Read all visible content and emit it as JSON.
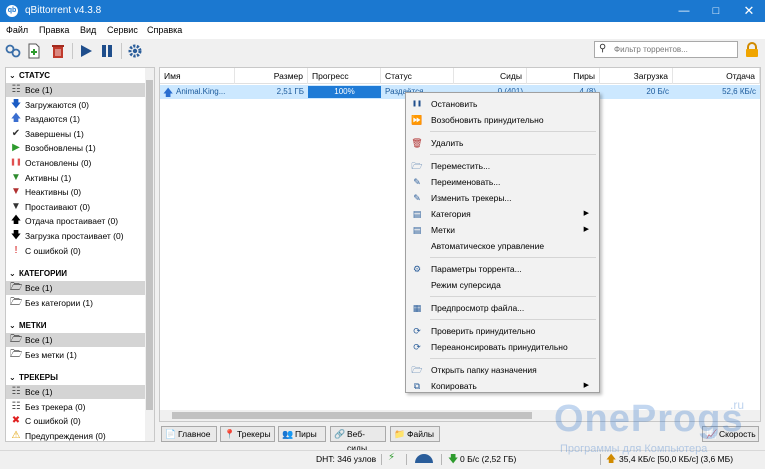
{
  "window": {
    "title": "qBittorrent v4.3.8",
    "app_icon": "qb"
  },
  "menubar": [
    "Файл",
    "Правка",
    "Вид",
    "Сервис",
    "Справка"
  ],
  "toolbar": {
    "icons": [
      "add-torrent-link-icon",
      "add-torrent-file-icon",
      "delete-icon",
      "resume-icon",
      "pause-icon",
      "options-gear-icon"
    ],
    "filter_placeholder": "Фильтр торрентов..."
  },
  "sidebar": {
    "status": {
      "title": "СТАТУС",
      "items": [
        {
          "label": "Все (1)",
          "icon": "all-icon",
          "color": "#555555"
        },
        {
          "label": "Загружаются (0)",
          "icon": "download-arrow-icon",
          "color": "#1a5bc4"
        },
        {
          "label": "Раздаются (1)",
          "icon": "upload-arrow-icon",
          "color": "#3a6ed0"
        },
        {
          "label": "Завершены (1)",
          "icon": "check-icon",
          "color": "#333333"
        },
        {
          "label": "Возобновлены (1)",
          "icon": "play-icon",
          "color": "#2e9b2e"
        },
        {
          "label": "Остановлены (0)",
          "icon": "pause-icon",
          "color": "#e05050"
        },
        {
          "label": "Активны (1)",
          "icon": "funnel-icon",
          "color": "#2e8b2e"
        },
        {
          "label": "Неактивны (0)",
          "icon": "funnel-icon",
          "color": "#b03030"
        },
        {
          "label": "Простаивают (0)",
          "icon": "funnel-icon",
          "color": "#333333"
        },
        {
          "label": "Отдача простаивает (0)",
          "icon": "up-arrow-icon",
          "color": "#000000"
        },
        {
          "label": "Загрузка простаивает (0)",
          "icon": "down-arrow-icon",
          "color": "#000000"
        },
        {
          "label": "С ошибкой (0)",
          "icon": "error-exclamation-icon",
          "color": "#d00000"
        }
      ]
    },
    "categories": {
      "title": "КАТЕГОРИИ",
      "items": [
        "Все (1)",
        "Без категории (1)"
      ]
    },
    "tags": {
      "title": "МЕТКИ",
      "items": [
        "Все (1)",
        "Без метки (1)"
      ]
    },
    "trackers": {
      "title": "ТРЕКЕРЫ",
      "items": [
        {
          "label": "Все (1)",
          "icon": "tracker-icon",
          "color": "#555555"
        },
        {
          "label": "Без трекера (0)",
          "icon": "tracker-icon",
          "color": "#555555"
        },
        {
          "label": "С ошибкой (0)",
          "icon": "error-circle-icon",
          "color": "#e02020"
        },
        {
          "label": "Предупреждения (0)",
          "icon": "warning-icon",
          "color": "#e0a000"
        }
      ]
    }
  },
  "table": {
    "columns": [
      "Имя",
      "Размер",
      "Прогресс",
      "Статус",
      "Сиды",
      "Пиры",
      "Загрузка",
      "Отдача"
    ],
    "rows": [
      {
        "name": "Animal.King...",
        "size": "2,51 ГБ",
        "progress_text": "100%",
        "progress": 1.0,
        "status": "Раздаётся",
        "seeds": "0 (401)",
        "peers": "4 (8)",
        "download": "20 Б/с",
        "upload": "52,6 КБ/с"
      }
    ]
  },
  "context_menu": {
    "items": [
      {
        "label": "Остановить",
        "icon": "pause-icon"
      },
      {
        "label": "Возобновить принудительно",
        "icon": "force-resume-icon"
      },
      {
        "separator": true
      },
      {
        "label": "Удалить",
        "icon": "delete-icon"
      },
      {
        "separator": true
      },
      {
        "label": "Переместить...",
        "icon": "folder-move-icon"
      },
      {
        "label": "Переименовать...",
        "icon": "rename-icon"
      },
      {
        "label": "Изменить трекеры...",
        "icon": "edit-trackers-icon"
      },
      {
        "label": "Категория",
        "icon": "category-icon",
        "submenu": true
      },
      {
        "label": "Метки",
        "icon": "tags-icon",
        "submenu": true
      },
      {
        "label": "Автоматическое управление",
        "icon": ""
      },
      {
        "separator": true
      },
      {
        "label": "Параметры торрента...",
        "icon": "gear-icon"
      },
      {
        "label": "Режим суперсида",
        "icon": ""
      },
      {
        "separator": true
      },
      {
        "label": "Предпросмотр файла...",
        "icon": "preview-icon"
      },
      {
        "separator": true
      },
      {
        "label": "Проверить принудительно",
        "icon": "recheck-icon"
      },
      {
        "label": "Переанонсировать принудительно",
        "icon": "reannounce-icon"
      },
      {
        "separator": true
      },
      {
        "label": "Открыть папку назначения",
        "icon": "folder-open-icon"
      },
      {
        "label": "Копировать",
        "icon": "copy-icon",
        "submenu": true
      }
    ]
  },
  "bottom_tabs": [
    {
      "label": "Главное",
      "icon": "general-icon"
    },
    {
      "label": "Трекеры",
      "icon": "trackers-icon"
    },
    {
      "label": "Пиры",
      "icon": "peers-icon"
    },
    {
      "label": "Веб-сиды",
      "icon": "webseeds-icon"
    },
    {
      "label": "Файлы",
      "icon": "files-icon"
    },
    {
      "label": "Скорость",
      "icon": "speed-icon"
    }
  ],
  "statusbar": {
    "dht": "DHT: 346 узлов",
    "download": "0 Б/с (2,52 ГБ)",
    "upload": "35,4 КБ/с [50,0 КБ/с] (3,6 МБ)"
  },
  "watermark": {
    "main": "OneProgs",
    "ru": ".ru",
    "sub": "Программы для Компьютера"
  },
  "colors": {
    "accent": "#1b78d0",
    "selection": "#cce8ff",
    "progress": "#1f7bd6"
  }
}
